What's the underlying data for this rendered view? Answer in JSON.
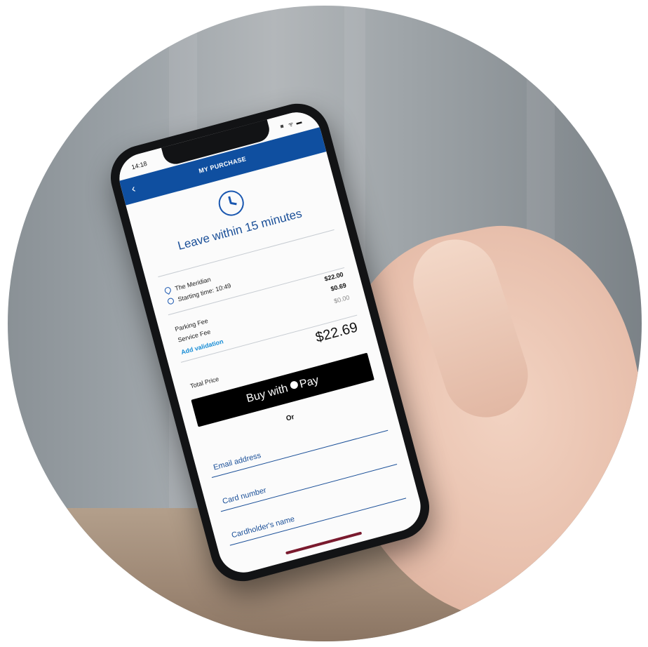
{
  "status_bar": {
    "time": "14:18",
    "signal_icons": "◾ ᯤ ▬"
  },
  "header": {
    "title": "MY PURCHASE",
    "back_icon": "chevron-left-icon"
  },
  "timer": {
    "icon": "clock-icon",
    "headline": "Leave within 15 minutes"
  },
  "location": {
    "name": "The Meridian",
    "start_label": "Starting time: 10:49"
  },
  "fees": [
    {
      "label": "Parking Fee",
      "amount": "$22.00"
    },
    {
      "label": "Service Fee",
      "amount": "$0.69"
    }
  ],
  "validation": {
    "label": "Add validation",
    "amount": "$0.00"
  },
  "total": {
    "label": "Total Price",
    "amount": "$22.69"
  },
  "apple_pay": {
    "prefix": "Buy with",
    "suffix": "Pay"
  },
  "separator": "Or",
  "form": {
    "email_placeholder": "Email address",
    "card_placeholder": "Card number",
    "cardholder_placeholder": "Cardholder's name"
  },
  "colors": {
    "brand_blue": "#0f4fa0",
    "link_blue": "#1a8ed6",
    "apple_pay_black": "#000000"
  }
}
